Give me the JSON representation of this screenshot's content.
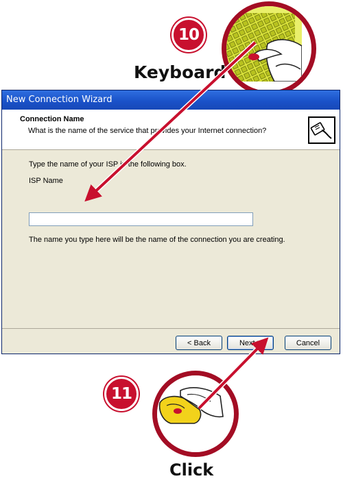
{
  "callouts": {
    "step10": {
      "number": "10",
      "label": "Keyboard"
    },
    "step11": {
      "number": "11",
      "label": "Click"
    }
  },
  "window": {
    "title": "New Connection Wizard",
    "header": {
      "title": "Connection Name",
      "subtitle": "What is the name of the service that provides your Internet connection?"
    },
    "content": {
      "instruction": "Type the name of your ISP in the following box.",
      "field_label": "ISP Name",
      "field_value": "",
      "note": "The name you type here will be the name of the connection you are creating."
    },
    "buttons": {
      "back": "< Back",
      "next": "Next >",
      "cancel": "Cancel"
    }
  },
  "colors": {
    "accent_red": "#c8102e",
    "titlebar_blue": "#1a52c9",
    "dialog_bg": "#ece9d8"
  },
  "icons": [
    "network-cable-icon",
    "keyboard-hand-icon",
    "mouse-hand-icon"
  ]
}
